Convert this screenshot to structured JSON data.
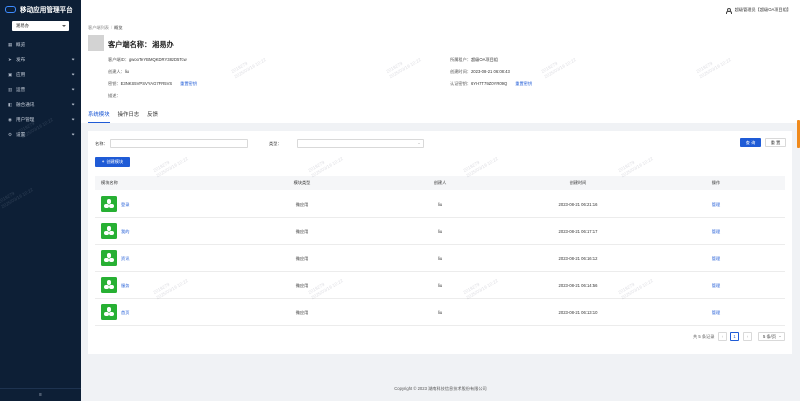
{
  "app": {
    "title": "移动应用管理平台"
  },
  "sidebar": {
    "selected_app": "湘易办",
    "items": [
      {
        "label": "概览",
        "icon": "grid-icon",
        "has_arrow": false
      },
      {
        "label": "发布",
        "icon": "send-icon",
        "has_arrow": true
      },
      {
        "label": "应用",
        "icon": "apps-icon",
        "has_arrow": true
      },
      {
        "label": "运营",
        "icon": "chart-icon",
        "has_arrow": true
      },
      {
        "label": "融合通讯",
        "icon": "message-icon",
        "has_arrow": true
      },
      {
        "label": "用户管理",
        "icon": "users-icon",
        "has_arrow": true
      },
      {
        "label": "设置",
        "icon": "gear-icon",
        "has_arrow": true
      }
    ],
    "collapse_icon": "≡"
  },
  "topbar": {
    "user": "超级管理员【超级OA项目组】"
  },
  "breadcrumb": {
    "parent": "客户端列表",
    "separator": "/",
    "current": "概览"
  },
  "client": {
    "title_label": "客户端名称：",
    "title_value": "湘易办",
    "id_label": "客户端ID：",
    "id_value": "gwooTeYBMQKDRY38zD5Tcw",
    "creator_label": "创建人：",
    "creator_value": "liu",
    "key_label": "密钥：",
    "key_value": "E3NKS5VPSVYAG7FR5VS",
    "key_reset": "重置密钥",
    "desc_label": "描述：",
    "desc_value": "",
    "tenant_label": "所属租户：",
    "tenant_value": "超级OA项目组",
    "created_label": "创建时间：",
    "created_value": "2023-08-21 06:08:43",
    "auth_key_label": "认证密钥：",
    "auth_key_value": "6YH7T79Z0YR09Q",
    "auth_key_reset": "重置密钥"
  },
  "tabs": [
    {
      "label": "系统模块",
      "active": true
    },
    {
      "label": "操作日志",
      "active": false
    },
    {
      "label": "反馈",
      "active": false
    }
  ],
  "filters": {
    "name_label": "名称：",
    "name_value": "",
    "type_label": "类型：",
    "type_value": "",
    "query_button": "查 询",
    "reset_button": "重 置",
    "create_button": "创建模块",
    "create_plus": "+"
  },
  "table": {
    "headers": [
      "模块名称",
      "模块类型",
      "创建人",
      "创建时间",
      "操作"
    ],
    "rows": [
      {
        "name": "登录",
        "type": "微应用",
        "creator": "liu",
        "created": "2023-08-21 06:21:16",
        "action": "管理"
      },
      {
        "name": "我的",
        "type": "微应用",
        "creator": "liu",
        "created": "2023-08-21 06:17:17",
        "action": "管理"
      },
      {
        "name": "资讯",
        "type": "微应用",
        "creator": "liu",
        "created": "2023-08-21 06:16:12",
        "action": "管理"
      },
      {
        "name": "服务",
        "type": "微应用",
        "creator": "liu",
        "created": "2023-08-21 06:14:56",
        "action": "管理"
      },
      {
        "name": "首页",
        "type": "微应用",
        "creator": "liu",
        "created": "2023-08-21 06:13:10",
        "action": "管理"
      }
    ]
  },
  "pagination": {
    "total": "共 5 条记录",
    "prev": "‹",
    "current": "1",
    "next": "›",
    "page_size": "5 条/页"
  },
  "footer": {
    "copyright": "Copyright © 2023 湖南科技信息技术股份有限公司"
  },
  "watermark": {
    "line1": "2019279",
    "line2": "2025/03/19 10:22"
  },
  "colors": {
    "primary": "#1f5bd6",
    "sidebar": "#0d1f36",
    "module_icon": "#27b033",
    "accent": "#f08a1c"
  }
}
